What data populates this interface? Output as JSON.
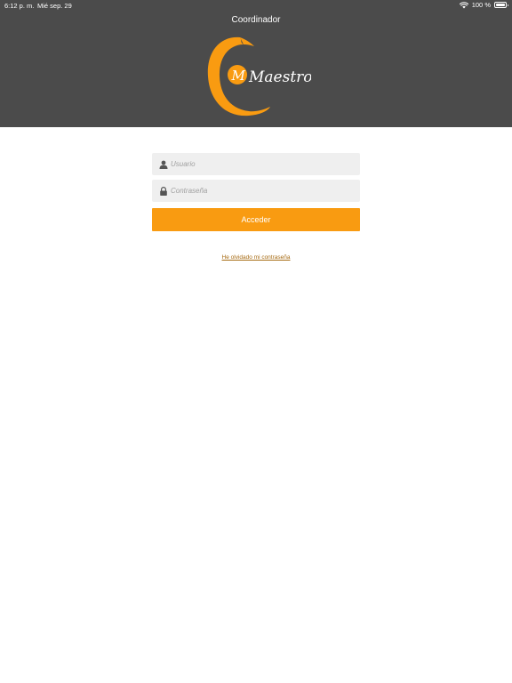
{
  "status_bar": {
    "time": "6:12 p. m.",
    "date": "Mié sep. 29",
    "battery": "100 %",
    "wifi_icon": "wifi-icon",
    "battery_icon": "battery-full-icon"
  },
  "header": {
    "title": "Coordinador",
    "background_color": "#4b4b4b"
  },
  "logo": {
    "text": "Maestro",
    "initial": "M",
    "color": "#f99b11"
  },
  "login": {
    "username_placeholder": "Usuario",
    "username_icon": "user-icon",
    "password_placeholder": "Contraseña",
    "password_icon": "lock-icon",
    "submit_label": "Acceder",
    "forgot_password_label": "He olvidado mi contraseña",
    "accent_color": "#f99b11"
  }
}
